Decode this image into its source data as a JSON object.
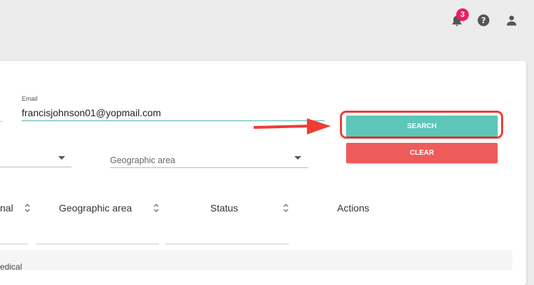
{
  "header": {
    "notification_count": "3",
    "icons": [
      "bell-icon",
      "help-icon",
      "user-icon"
    ]
  },
  "filters": {
    "email_label": "Email",
    "email_value": "francisjohnson01@yopmail.com",
    "geographic_area_label": "Geographic area"
  },
  "actions": {
    "search_label": "SEARCH",
    "clear_label": "CLEAR"
  },
  "table": {
    "columns": [
      "nal",
      "Geographic area",
      "Status",
      "Actions"
    ],
    "row_partial": {
      "col1": "edical"
    }
  },
  "colors": {
    "accent": "#5cc6b8",
    "danger": "#ef5b5b",
    "highlight": "#ef3d33",
    "badge": "#e91e63"
  }
}
